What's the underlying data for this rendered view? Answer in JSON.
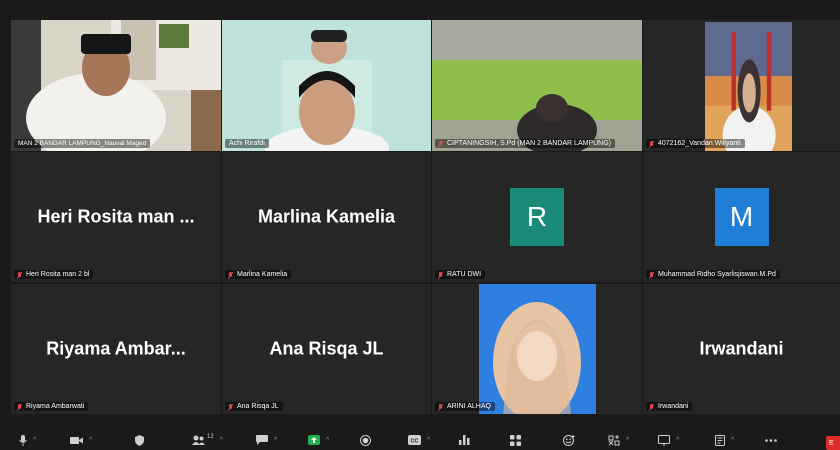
{
  "tiles": [
    {
      "name": "MAN 2 BANDAR LAMPUNG_Nauval Maged",
      "type": "video",
      "video": "man-at-desk"
    },
    {
      "name": "Achi Rirafdi",
      "type": "video",
      "video": "man-with-child"
    },
    {
      "name": "CIPTANINGSIH, S.Pd (MAN 2 BANDAR LAMPUNG)",
      "type": "video",
      "video": "blurred-room"
    },
    {
      "name": "4072162_Vandan Wiliyanti",
      "type": "video",
      "video": "woman-bridge-background"
    },
    {
      "name": "Heri Rosita man 2 bl",
      "type": "name",
      "display": "Heri  Rosita  man ..."
    },
    {
      "name": "Marlina Kamelia",
      "type": "name",
      "display": "Marlina Kamelia"
    },
    {
      "name": "RATU DWI",
      "type": "avatar",
      "initial": "R",
      "color": "#1a8a78"
    },
    {
      "name": "Muhammad Ridho Syarlisjiswan.M.Pd",
      "type": "avatar",
      "initial": "M",
      "color": "#1f7ed6"
    },
    {
      "name": "Riyama Ambarwati",
      "type": "name",
      "display": "Riyama  Ambar..."
    },
    {
      "name": "Ana Risqa JL",
      "type": "name",
      "display": "Ana Risqa JL"
    },
    {
      "name": "ARINI ALHAQ",
      "type": "photo",
      "photo": "woman-hijab-blue-background"
    },
    {
      "name": "Irwandani",
      "type": "name",
      "display": "Irwandani"
    }
  ],
  "toolbar": {
    "participants_count": "12",
    "end_label": "E"
  },
  "colors": {
    "active_speaker_border": "#c8e36a",
    "tile_bg": "#262626",
    "share_green": "#22b14c",
    "end_red": "#e02b2b"
  }
}
